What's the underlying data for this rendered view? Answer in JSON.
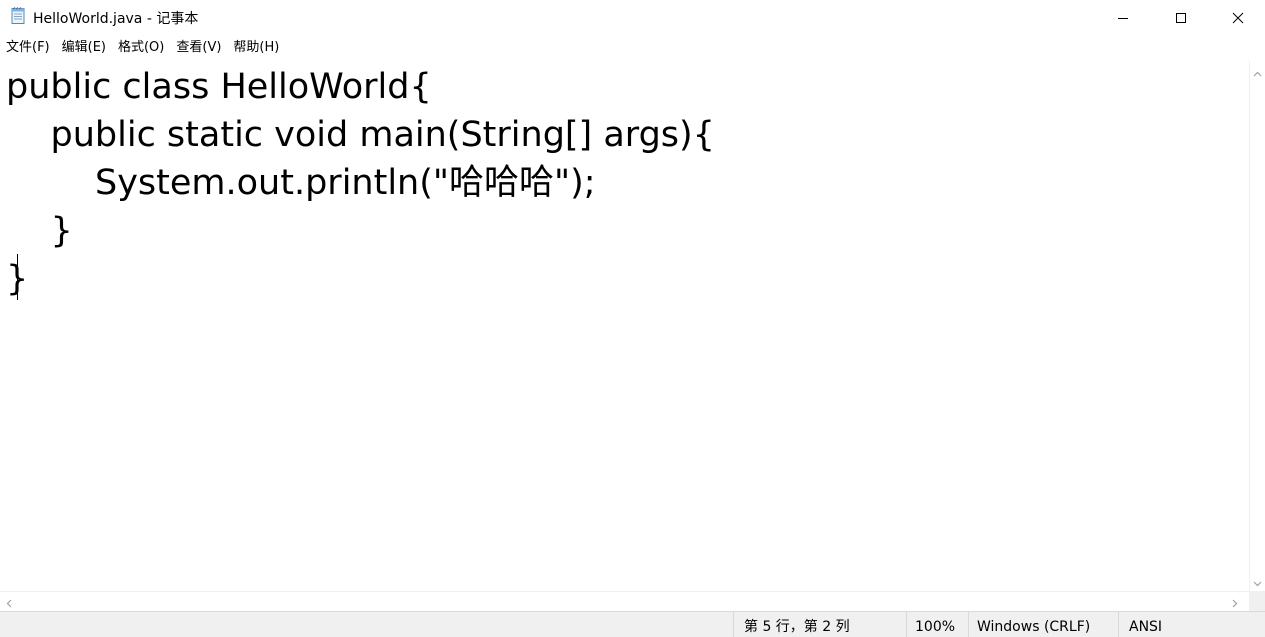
{
  "window": {
    "title": "HelloWorld.java - 记事本",
    "app_icon": "notepad-icon",
    "controls": {
      "minimize_icon": "minimize-icon",
      "maximize_icon": "maximize-icon",
      "close_icon": "close-icon"
    }
  },
  "menu": {
    "items": [
      {
        "label": "文件(F)"
      },
      {
        "label": "编辑(E)"
      },
      {
        "label": "格式(O)"
      },
      {
        "label": "查看(V)"
      },
      {
        "label": "帮助(H)"
      }
    ]
  },
  "editor": {
    "lines": [
      "public class HelloWorld{",
      "    public static void main(String[] args){",
      "        System.out.println(\"哈哈哈\");",
      "    }",
      "}"
    ]
  },
  "status": {
    "position": "第 5 行，第 2 列",
    "zoom": "100%",
    "line_ending": "Windows (CRLF)",
    "encoding": "ANSI"
  },
  "colors": {
    "background": "#ffffff",
    "statusbar": "#f0f0f0",
    "text": "#000000"
  }
}
